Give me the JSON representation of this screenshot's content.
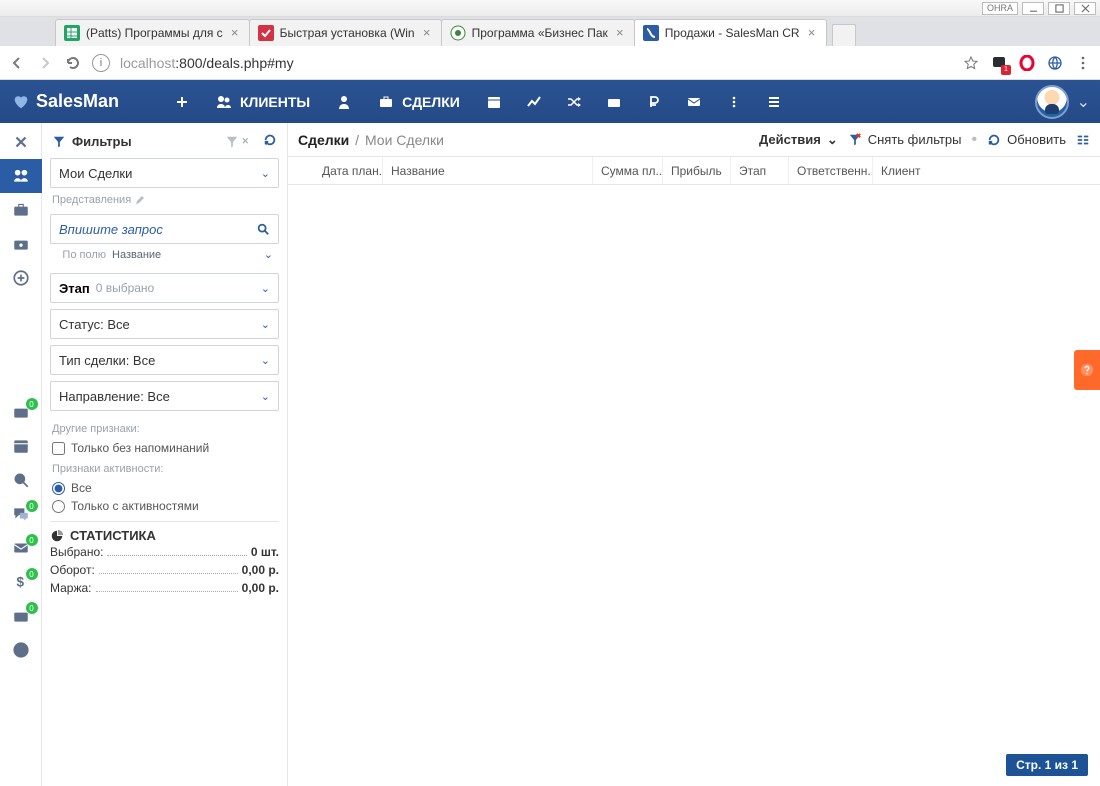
{
  "window": {
    "ohra": "OHRA",
    "tabs": [
      {
        "title": "(Patts) Программы для c",
        "favicon": "sheets"
      },
      {
        "title": "Быстрая установка (Win",
        "favicon": "red"
      },
      {
        "title": "Программа «Бизнес Пак",
        "favicon": "green"
      },
      {
        "title": "Продажи - SalesMan CR",
        "favicon": "blue",
        "active": true
      }
    ],
    "url_muted": "localhost",
    "url_rest": ":800/deals.php#my",
    "ext_badge": "1"
  },
  "nav": {
    "brand": "SalesMan",
    "items": {
      "clients": "КЛИЕНТЫ",
      "deals": "СДЕЛКИ"
    }
  },
  "filters": {
    "title": "Фильтры",
    "preset": "Мои Сделки",
    "views_label": "Представления",
    "search_placeholder": "Впишите запрос",
    "byfield_label": "По полю",
    "byfield_value": "Название",
    "stage_label": "Этап",
    "stage_count": "0 выбрано",
    "status": "Статус: Все",
    "dealtype": "Тип сделки: Все",
    "direction": "Направление: Все",
    "other_section": "Другие признаки:",
    "chk_noreminders": "Только без напоминаний",
    "activity_section": "Признаки активности:",
    "radio_all": "Все",
    "radio_withact": "Только с активностями",
    "stats_title": "СТАТИСТИКА",
    "stats": {
      "selected_lbl": "Выбрано:",
      "selected_val": "0 шт.",
      "turnover_lbl": "Оборот:",
      "turnover_val": "0,00 р.",
      "margin_lbl": "Маржа:",
      "margin_val": "0,00 р."
    }
  },
  "main": {
    "crumb_root": "Сделки",
    "crumb_current": "Мои Сделки",
    "actions": {
      "actions": "Действия",
      "clear": "Снять фильтры",
      "refresh": "Обновить"
    },
    "columns": {
      "date": "Дата план.",
      "name": "Название",
      "sum": "Сумма пл...",
      "profit": "Прибыль",
      "stage": "Этап",
      "owner": "Ответственн...",
      "client": "Клиент"
    },
    "page_badge": "Стр. 1 из 1"
  },
  "minibar_badges": {
    "b1": "0",
    "b2": "0",
    "b3": "0",
    "b4": "0",
    "b5": "0"
  }
}
